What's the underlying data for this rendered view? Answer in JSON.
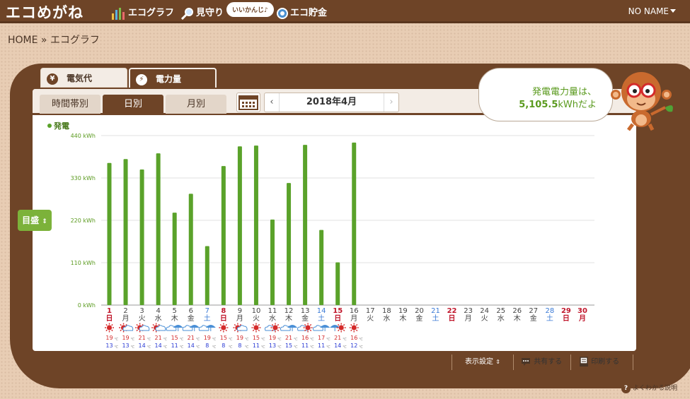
{
  "header": {
    "logo": "エコめがね",
    "nav": [
      {
        "label": "エコグラフ",
        "icon": "bar-chart-icon"
      },
      {
        "label": "見守り",
        "icon": "magnifier-icon"
      },
      {
        "label": "エコ貯金",
        "icon": "coin-icon"
      }
    ],
    "speech": "いいかんじ♪",
    "user": "NO NAME"
  },
  "breadcrumb": "HOME » エコグラフ",
  "tabs_top": [
    {
      "label": "電気代",
      "icon": "yen-icon",
      "active": false
    },
    {
      "label": "電力量",
      "icon": "bolt-icon",
      "active": true
    }
  ],
  "tabs_sub": [
    {
      "label": "時間帯別",
      "active": false
    },
    {
      "label": "日別",
      "active": true
    },
    {
      "label": "月別",
      "active": false
    }
  ],
  "month_nav": {
    "prev": "‹",
    "label": "2018年4月",
    "next": "›"
  },
  "bubble": {
    "line1": "発電電力量は、",
    "line2_value": "5,105.5",
    "line2_unit": "kWhだよ"
  },
  "scale_button": "目盛",
  "bottom": {
    "display_settings": "表示設定",
    "share": "共有する",
    "print": "印刷する",
    "help": "よくわかる説明"
  },
  "colors": {
    "brand": "#6e4427",
    "bar": "#5aa22a",
    "sun": "#d42a2a",
    "rain": "#4a8fd6",
    "sunday": "#c0162b",
    "saturday": "#3a7ad6"
  },
  "chart_data": {
    "type": "bar",
    "series": [
      {
        "name": "発電",
        "values": [
          369,
          379,
          352,
          394,
          240,
          289,
          153,
          361,
          412,
          414,
          222,
          317,
          416,
          195,
          111,
          422,
          null,
          null,
          null,
          null,
          null,
          null,
          null,
          null,
          null,
          null,
          null,
          null,
          null,
          null
        ]
      }
    ],
    "categories": [
      "1",
      "2",
      "3",
      "4",
      "5",
      "6",
      "7",
      "8",
      "9",
      "10",
      "11",
      "12",
      "13",
      "14",
      "15",
      "16",
      "17",
      "18",
      "19",
      "20",
      "21",
      "22",
      "23",
      "24",
      "25",
      "26",
      "27",
      "28",
      "29",
      "30"
    ],
    "weekdays": [
      "日",
      "月",
      "火",
      "水",
      "木",
      "金",
      "土",
      "日",
      "月",
      "火",
      "水",
      "木",
      "金",
      "土",
      "日",
      "月",
      "火",
      "水",
      "木",
      "金",
      "土",
      "日",
      "月",
      "火",
      "水",
      "木",
      "金",
      "土",
      "日",
      "月"
    ],
    "day_types": [
      "sun",
      "wk",
      "wk",
      "wk",
      "wk",
      "wk",
      "sat",
      "sun",
      "wk",
      "wk",
      "wk",
      "wk",
      "wk",
      "sat",
      "sun",
      "wk",
      "wk",
      "wk",
      "wk",
      "wk",
      "sat",
      "sun",
      "wk",
      "wk",
      "wk",
      "wk",
      "wk",
      "sat",
      "sun",
      "hol"
    ],
    "weather": [
      "sun",
      "sun-cloud",
      "sun-cloud",
      "sun-cloud",
      "cloud-rain",
      "cloud-rain",
      "cloud-rain",
      "sun",
      "sun-cloud",
      "sun",
      "cloud-sun",
      "cloud-rain",
      "cloud-sun",
      "cloud-rain",
      "rain-sun",
      "sun"
    ],
    "temp_high": [
      19,
      19,
      21,
      21,
      15,
      21,
      19,
      15,
      19,
      15,
      19,
      21,
      16,
      17,
      21,
      16
    ],
    "temp_low": [
      13,
      13,
      14,
      14,
      11,
      14,
      8,
      8,
      8,
      11,
      13,
      15,
      11,
      11,
      14,
      12
    ],
    "temp_unit": "℃",
    "ylim": [
      0,
      440
    ],
    "yticks": [
      {
        "v": 0,
        "label": "0 kWh"
      },
      {
        "v": 110,
        "label": "110 kWh"
      },
      {
        "v": 220,
        "label": "220 kWh"
      },
      {
        "v": 330,
        "label": "330 kWh"
      },
      {
        "v": 440,
        "label": "440 kWh"
      }
    ],
    "grid": true
  }
}
